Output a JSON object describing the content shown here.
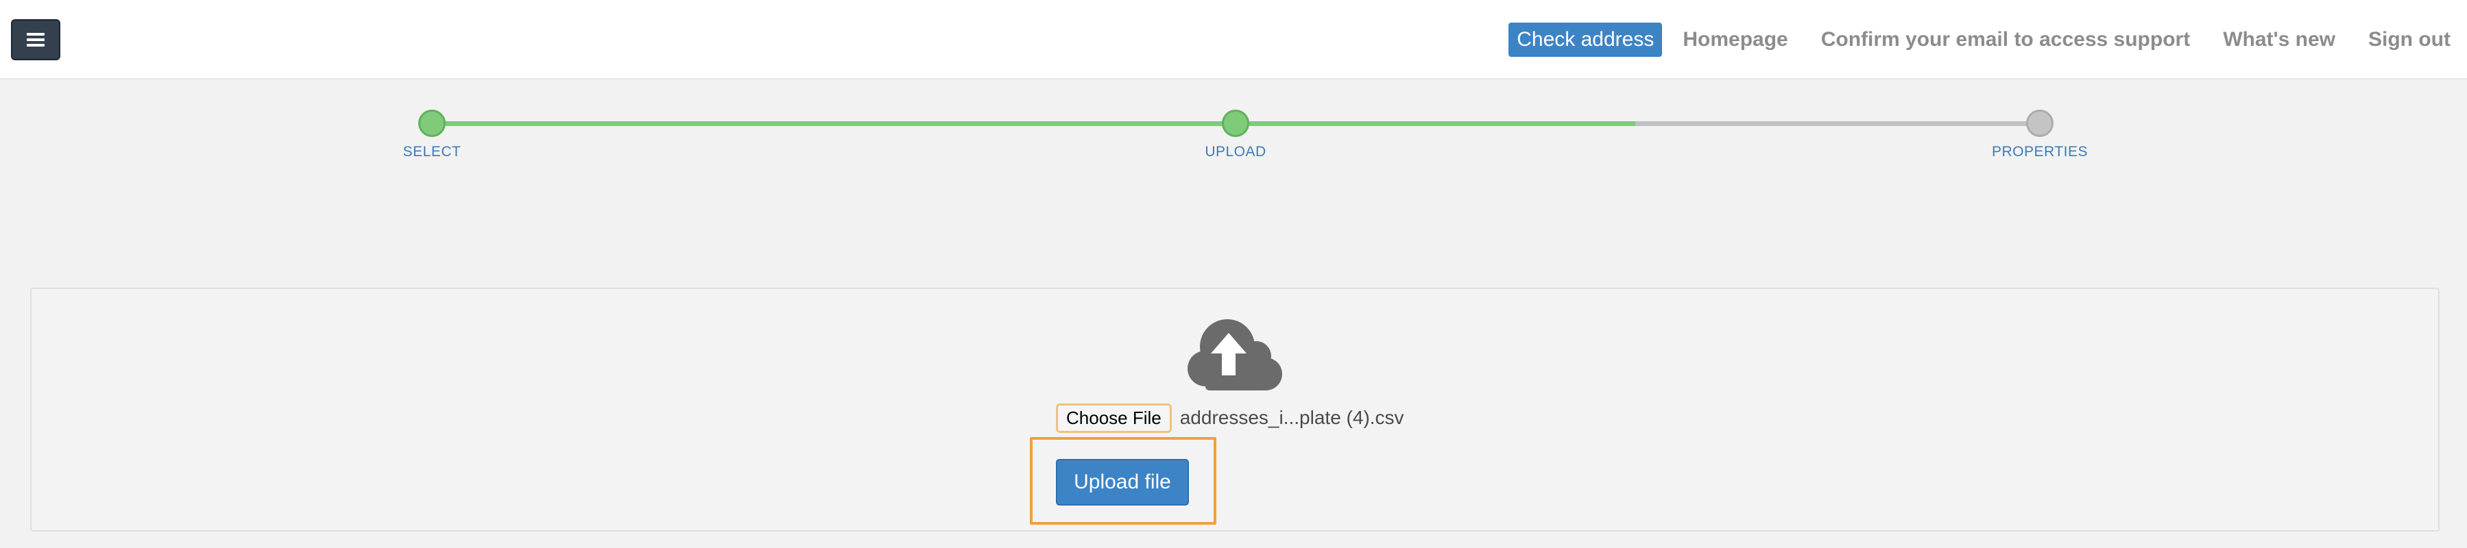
{
  "header": {
    "menu_icon": "hamburger-menu-icon",
    "nav": [
      {
        "label": "Check address",
        "active": true
      },
      {
        "label": "Homepage",
        "active": false
      },
      {
        "label": "Confirm your email to access support",
        "active": false
      },
      {
        "label": "What's new",
        "active": false
      },
      {
        "label": "Sign out",
        "active": false
      }
    ]
  },
  "stepper": {
    "steps": [
      {
        "label": "SELECT",
        "status": "complete"
      },
      {
        "label": "UPLOAD",
        "status": "complete"
      },
      {
        "label": "PROPERTIES",
        "status": "pending"
      }
    ],
    "progress_fraction": 0.75
  },
  "upload": {
    "icon": "cloud-upload-icon",
    "choose_file_label": "Choose File",
    "file_name": "addresses_i...plate (4).csv",
    "upload_button_label": "Upload file"
  },
  "colors": {
    "accent": "#3d84c6",
    "step_complete": "#7fcb7a",
    "step_pending": "#c4c4c4",
    "highlight": "#f0a040",
    "menu_button": "#34404d"
  }
}
